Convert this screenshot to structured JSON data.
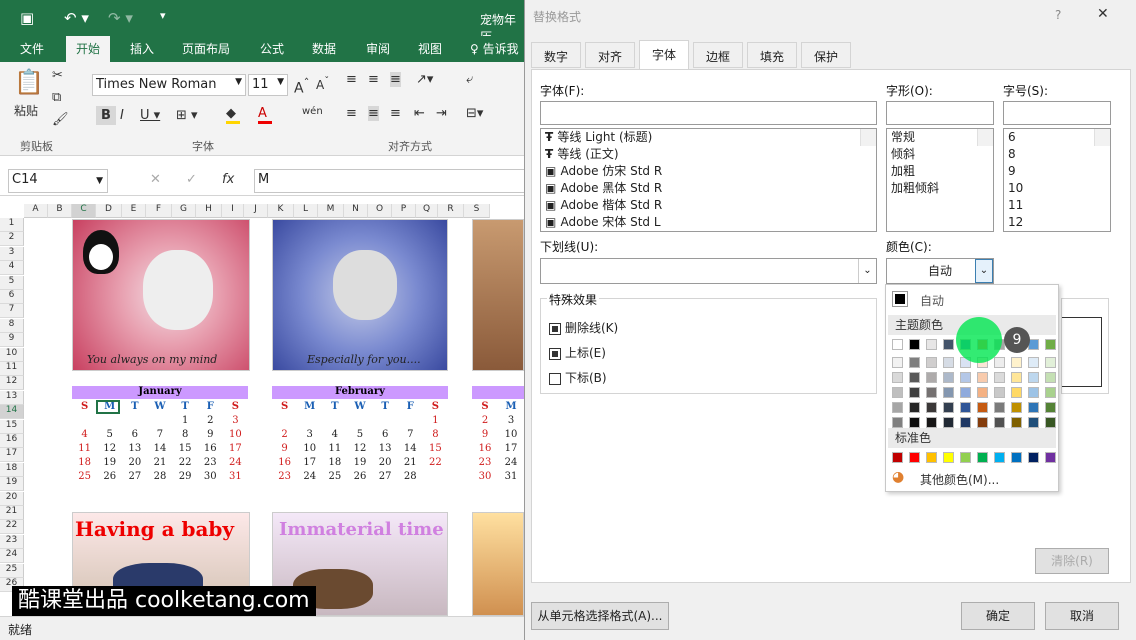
{
  "excel": {
    "window_title": "宠物年历",
    "tabs": [
      "文件",
      "开始",
      "插入",
      "页面布局",
      "公式",
      "数据",
      "审阅",
      "视图",
      "告诉我"
    ],
    "font_name": "Times New Roman",
    "font_size": "11",
    "paste_label": "粘贴",
    "groups": {
      "clipboard": "剪贴板",
      "font": "字体",
      "align": "对齐方式"
    },
    "cell_ref": "C14",
    "formula_value": "M",
    "col_headers": [
      "A",
      "B",
      "C",
      "D",
      "E",
      "F",
      "G",
      "H",
      "I",
      "J",
      "K",
      "L",
      "M",
      "N",
      "O",
      "P",
      "Q",
      "R",
      "S"
    ],
    "row_headers": [
      "1",
      "2",
      "3",
      "4",
      "5",
      "6",
      "7",
      "8",
      "9",
      "10",
      "11",
      "12",
      "13",
      "14",
      "15",
      "16",
      "17",
      "18",
      "19",
      "20",
      "21",
      "22",
      "23",
      "24",
      "25",
      "26"
    ],
    "pic1_caption": "You always on my mind",
    "pic2_caption": "Especially for you....",
    "pic3_caption": "Having a baby",
    "pic4_caption": "Immaterial time",
    "jan": {
      "title": "January",
      "days": [
        "S",
        "M",
        "T",
        "W",
        "T",
        "F",
        "S"
      ],
      "cells": [
        "",
        "",
        "",
        "",
        "1",
        "2",
        "3",
        "4",
        "5",
        "6",
        "7",
        "8",
        "9",
        "10",
        "11",
        "12",
        "13",
        "14",
        "15",
        "16",
        "17",
        "18",
        "19",
        "20",
        "21",
        "22",
        "23",
        "24",
        "25",
        "26",
        "27",
        "28",
        "29",
        "30",
        "31",
        "",
        ""
      ]
    },
    "feb": {
      "title": "February",
      "days": [
        "S",
        "M",
        "T",
        "W",
        "T",
        "F",
        "S"
      ],
      "cells": [
        "",
        "",
        "",
        "",
        "",
        "",
        "1",
        "2",
        "3",
        "4",
        "5",
        "6",
        "7",
        "8",
        "9",
        "10",
        "11",
        "12",
        "13",
        "14",
        "15",
        "16",
        "17",
        "18",
        "19",
        "20",
        "21",
        "22",
        "23",
        "24",
        "25",
        "26",
        "27",
        "28",
        "",
        "",
        ""
      ]
    },
    "mar": {
      "days": [
        "S",
        "M"
      ],
      "cells": [
        "",
        "",
        "2",
        "3",
        "9",
        "10",
        "16",
        "17",
        "23",
        "24",
        "30",
        "31"
      ]
    },
    "status": "就绪",
    "watermark": "酷课堂出品 coolketang.com"
  },
  "dialog": {
    "title": "替换格式",
    "help": "?",
    "close": "✕",
    "tabs": [
      "数字",
      "对齐",
      "字体",
      "边框",
      "填充",
      "保护"
    ],
    "font_label": "字体(F):",
    "style_label": "字形(O):",
    "size_label": "字号(S):",
    "fonts": [
      "等线 Light (标题)",
      "等线 (正文)",
      "Adobe 仿宋 Std R",
      "Adobe 黑体 Std R",
      "Adobe 楷体 Std R",
      "Adobe 宋体 Std L"
    ],
    "styles": [
      "常规",
      "倾斜",
      "加粗",
      "加粗倾斜"
    ],
    "sizes": [
      "6",
      "8",
      "9",
      "10",
      "11",
      "12"
    ],
    "underline_label": "下划线(U):",
    "color_label": "颜色(C):",
    "color_value": "自动",
    "effects_label": "特殊效果",
    "effects": [
      "删除线(K)",
      "上标(E)",
      "下标(B)"
    ],
    "palette": {
      "auto": "自动",
      "theme": "主题颜色",
      "standard": "标准色",
      "more": "其他颜色(M)..."
    },
    "step_badge": "9",
    "clear_btn": "清除(R)",
    "pick_btn": "从单元格选择格式(A)...",
    "ok_btn": "确定",
    "cancel_btn": "取消"
  }
}
